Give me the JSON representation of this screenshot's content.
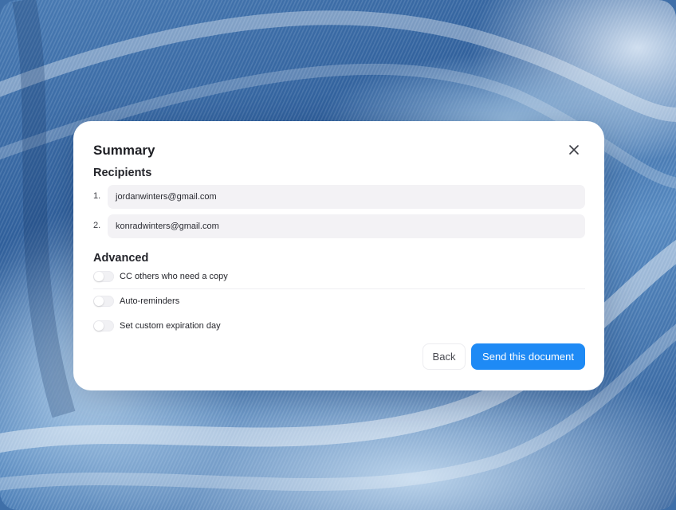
{
  "modal": {
    "title": "Summary",
    "recipients_title": "Recipients",
    "recipients": [
      {
        "number": "1.",
        "email": "jordanwinters@gmail.com"
      },
      {
        "number": "2.",
        "email": "konradwinters@gmail.com"
      }
    ],
    "advanced_title": "Advanced",
    "options": [
      {
        "label": "CC others who need a copy",
        "enabled": false
      },
      {
        "label": "Auto-reminders",
        "enabled": false
      },
      {
        "label": "Set custom expiration day",
        "enabled": false
      }
    ],
    "back_label": "Back",
    "send_label": "Send this document"
  },
  "icons": {
    "close": "close-icon"
  },
  "colors": {
    "primary_button": "#1e8af5",
    "field_background": "#f3f2f5"
  }
}
